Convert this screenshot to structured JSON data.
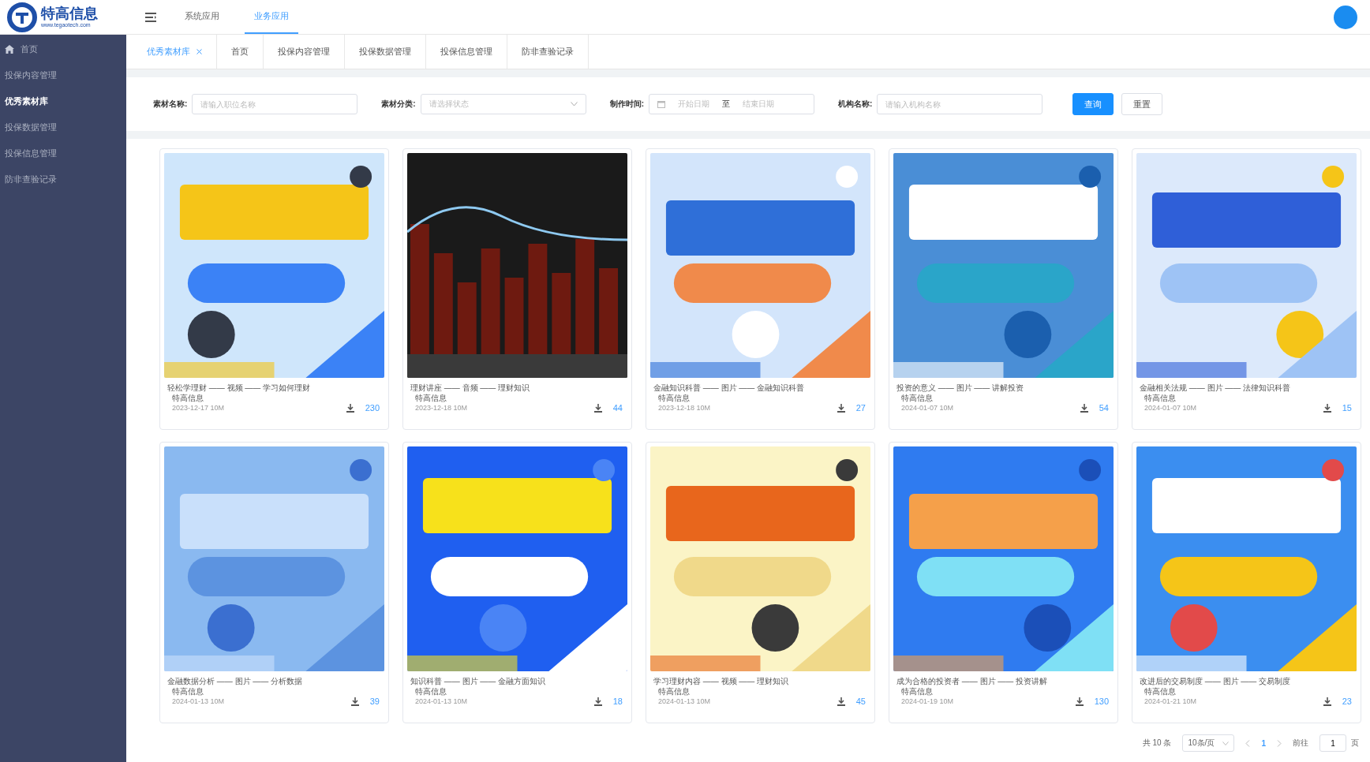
{
  "header": {
    "logo_text": "特高信息",
    "logo_url": "www.tegaotech.com",
    "nav": [
      {
        "label": "系统应用",
        "selected": false
      },
      {
        "label": "业务应用",
        "selected": true
      }
    ]
  },
  "sidebar": {
    "items": [
      {
        "label": "首页",
        "selected": false,
        "kind": "home"
      },
      {
        "label": "投保内容管理",
        "selected": false,
        "kind": "plain"
      },
      {
        "label": "优秀素材库",
        "selected": true,
        "kind": "plain"
      },
      {
        "label": "投保数据管理",
        "selected": false,
        "kind": "plain"
      },
      {
        "label": "投保信息管理",
        "selected": false,
        "kind": "plain"
      },
      {
        "label": "防非查验记录",
        "selected": false,
        "kind": "plain"
      }
    ]
  },
  "tabs": [
    {
      "label": "优秀素材库",
      "selected": true,
      "closable": true
    },
    {
      "label": "首页",
      "selected": false,
      "closable": false
    },
    {
      "label": "投保内容管理",
      "selected": false,
      "closable": false
    },
    {
      "label": "投保数据管理",
      "selected": false,
      "closable": false
    },
    {
      "label": "投保信息管理",
      "selected": false,
      "closable": false
    },
    {
      "label": "防非查验记录",
      "selected": false,
      "closable": false
    }
  ],
  "filters": [
    {
      "kind": "text",
      "label": "素材名称:",
      "placeholder": "请输入职位名称"
    },
    {
      "kind": "select",
      "label": "素材分类:",
      "placeholder": "请选择状态"
    },
    {
      "kind": "daterange",
      "label": "制作时间:",
      "start_placeholder": "开始日期",
      "separator": "至",
      "end_placeholder": "结束日期"
    },
    {
      "kind": "text",
      "label": "机构名称:",
      "placeholder": "请输入机构名称"
    }
  ],
  "buttons": [
    {
      "label": "查询",
      "kind": "primary"
    },
    {
      "label": "重置",
      "kind": "default"
    }
  ],
  "cards": [
    {
      "kind": "picture",
      "title": "轻松学理财 —— 视频 —— 学习如何理财",
      "author": "特高信息",
      "date": "2023-12-17 10M",
      "downloads": "230"
    },
    {
      "kind": "picture",
      "title": "理财讲座 —— 音频 —— 理财知识",
      "author": "特高信息",
      "date": "2023-12-18 10M",
      "downloads": "44"
    },
    {
      "kind": "picture",
      "title": "金融知识科普 —— 图片 —— 金融知识科普",
      "author": "特高信息",
      "date": "2023-12-18 10M",
      "downloads": "27"
    },
    {
      "kind": "picture",
      "title": "投资的意义 —— 图片 —— 讲解投资",
      "author": "特高信息",
      "date": "2024-01-07 10M",
      "downloads": "54"
    },
    {
      "kind": "picture",
      "title": "金融相关法规 —— 图片 —— 法律知识科普",
      "author": "特高信息",
      "date": "2024-01-07 10M",
      "downloads": "15"
    },
    {
      "kind": "picture",
      "title": "金融数据分析 —— 图片 —— 分析数据",
      "author": "特高信息",
      "date": "2024-01-13 10M",
      "downloads": "39"
    },
    {
      "kind": "picture",
      "title": "知识科普 —— 图片 —— 金融方面知识",
      "author": "特高信息",
      "date": "2024-01-13 10M",
      "downloads": "18"
    },
    {
      "kind": "picture",
      "title": "学习理财内容 —— 视频 —— 理财知识",
      "author": "特高信息",
      "date": "2024-01-13 10M",
      "downloads": "45"
    },
    {
      "kind": "picture",
      "title": "成为合格的投资者 —— 图片 —— 投资讲解",
      "author": "特高信息",
      "date": "2024-01-19 10M",
      "downloads": "130"
    },
    {
      "kind": "picture",
      "title": "改进后的交易制度 —— 图片 —— 交易制度",
      "author": "特高信息",
      "date": "2024-01-21 10M",
      "downloads": "23"
    }
  ],
  "pagination": {
    "total": "共 10 条",
    "page_size": "10条/页",
    "pages": [
      {
        "label": "1",
        "selected": true
      }
    ],
    "goto_label": "前往",
    "goto_value": "1",
    "page_suffix": "页"
  }
}
